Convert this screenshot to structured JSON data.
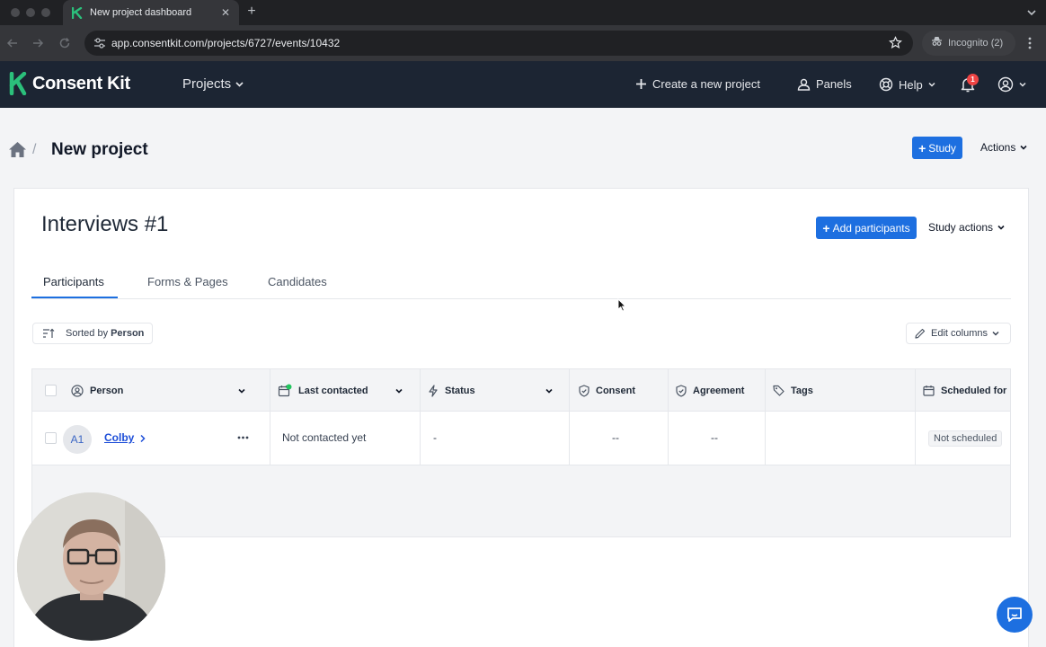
{
  "browser": {
    "tab_title": "New project dashboard",
    "url": "app.consentkit.com/projects/6727/events/10432",
    "incognito_label": "Incognito (2)"
  },
  "header": {
    "logo_text": "Consent Kit",
    "projects_label": "Projects",
    "create_project_label": "Create a new project",
    "panels_label": "Panels",
    "help_label": "Help",
    "notification_count": "1"
  },
  "page": {
    "title": "New project",
    "study_button": "Study",
    "actions_label": "Actions"
  },
  "study": {
    "title": "Interviews #1",
    "add_participants_label": "Add participants",
    "study_actions_label": "Study actions",
    "tabs": [
      {
        "label": "Participants",
        "active": true
      },
      {
        "label": "Forms & Pages",
        "active": false
      },
      {
        "label": "Candidates",
        "active": false
      }
    ],
    "sort_prefix": "Sorted by",
    "sort_field": "Person",
    "edit_columns_label": "Edit columns"
  },
  "table": {
    "columns": [
      "Person",
      "Last contacted",
      "Status",
      "Consent",
      "Agreement",
      "Tags",
      "Scheduled for"
    ],
    "rows": [
      {
        "avatar": "A1",
        "person": "Colby",
        "last_contacted": "Not contacted yet",
        "status": "-",
        "consent": "--",
        "agreement": "--",
        "tags": "",
        "scheduled": "Not scheduled"
      }
    ]
  },
  "colors": {
    "header_bg": "#1c2533",
    "accent": "#1d6fe0",
    "logo_green": "#2bc07b",
    "badge_red": "#ef4444"
  }
}
